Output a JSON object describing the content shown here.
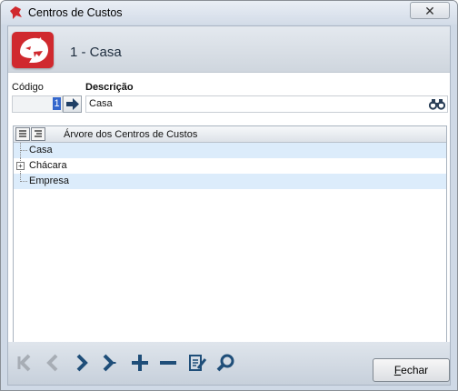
{
  "window": {
    "title": "Centros de Custos",
    "close_symbol": "✕"
  },
  "header": {
    "title": "1 - Casa"
  },
  "form": {
    "code_label": "Código",
    "code_value": "1",
    "description_label": "Descrição",
    "description_value": "Casa"
  },
  "tree": {
    "title": "Árvore dos Centros de Custos",
    "items": [
      {
        "label": "Casa",
        "expandable": false,
        "highlighted": true
      },
      {
        "label": "Chácara",
        "expandable": true,
        "highlighted": false
      },
      {
        "label": "Empresa",
        "expandable": false,
        "highlighted": true
      }
    ]
  },
  "toolbar": {
    "icons": [
      "first-icon",
      "previous-icon",
      "next-icon",
      "last-icon",
      "add-icon",
      "remove-icon",
      "edit-icon",
      "search-icon"
    ]
  },
  "buttons": {
    "close_label_first": "F",
    "close_label_rest": "echar"
  },
  "colors": {
    "accent": "#1f4e79",
    "logo_red": "#d0292e",
    "selection": "#dcecfb"
  }
}
